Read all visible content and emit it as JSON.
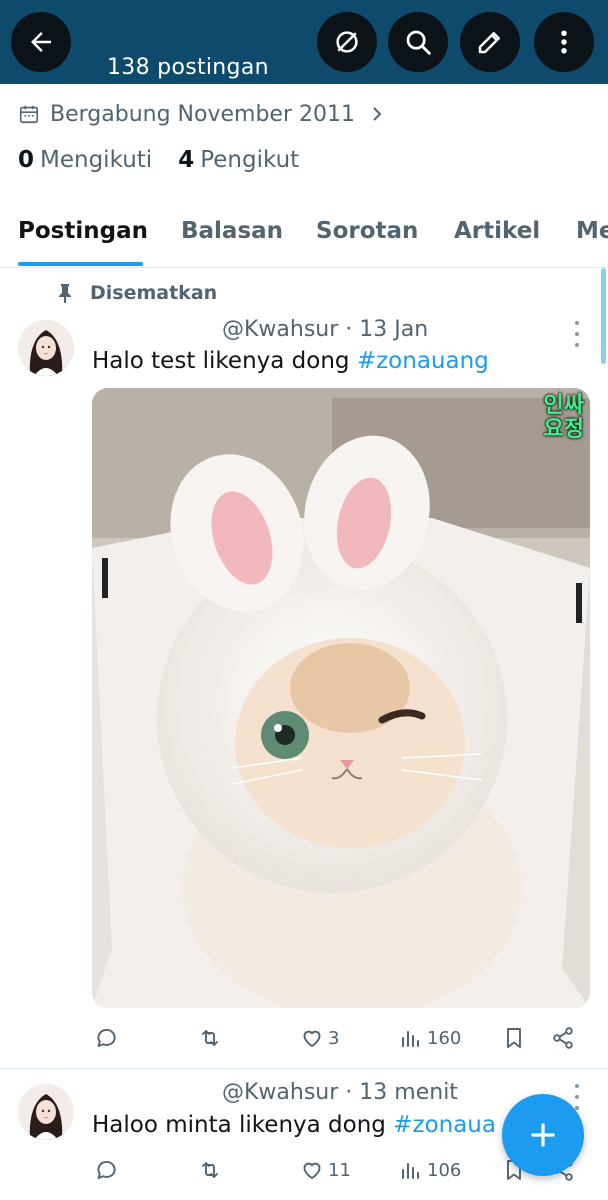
{
  "header": {
    "post_count": "138 postingan",
    "icons": [
      "back-arrow-icon",
      "grok-icon",
      "search-icon",
      "edit-icon",
      "more-vertical-icon"
    ]
  },
  "profile": {
    "joined": "Bergabung November 2011",
    "following_count": "0",
    "following_label": "Mengikuti",
    "followers_count": "4",
    "followers_label": "Pengikut"
  },
  "tabs": [
    {
      "label": "Postingan",
      "active": true
    },
    {
      "label": "Balasan",
      "active": false
    },
    {
      "label": "Sorotan",
      "active": false
    },
    {
      "label": "Artikel",
      "active": false
    },
    {
      "label": "Me",
      "active": false
    }
  ],
  "posts": [
    {
      "pinned_label": "Disematkan",
      "handle": "@Kwahsur",
      "separator": "·",
      "time": "13 Jan",
      "text": "Halo test likenya dong ",
      "hashtag": "#zonauang",
      "image_badge_line1": "인싸",
      "image_badge_line2": "요정",
      "likes": "3",
      "views": "160"
    },
    {
      "handle": "@Kwahsur",
      "separator": "·",
      "time": "13 menit",
      "text": "Haloo minta likenya dong ",
      "hashtag": "#zonaua",
      "likes": "11",
      "views": "106"
    }
  ],
  "colors": {
    "header_bg": "#0e4a6b",
    "accent": "#1d9bf0",
    "text_primary": "#0f1419",
    "text_secondary": "#536471"
  }
}
